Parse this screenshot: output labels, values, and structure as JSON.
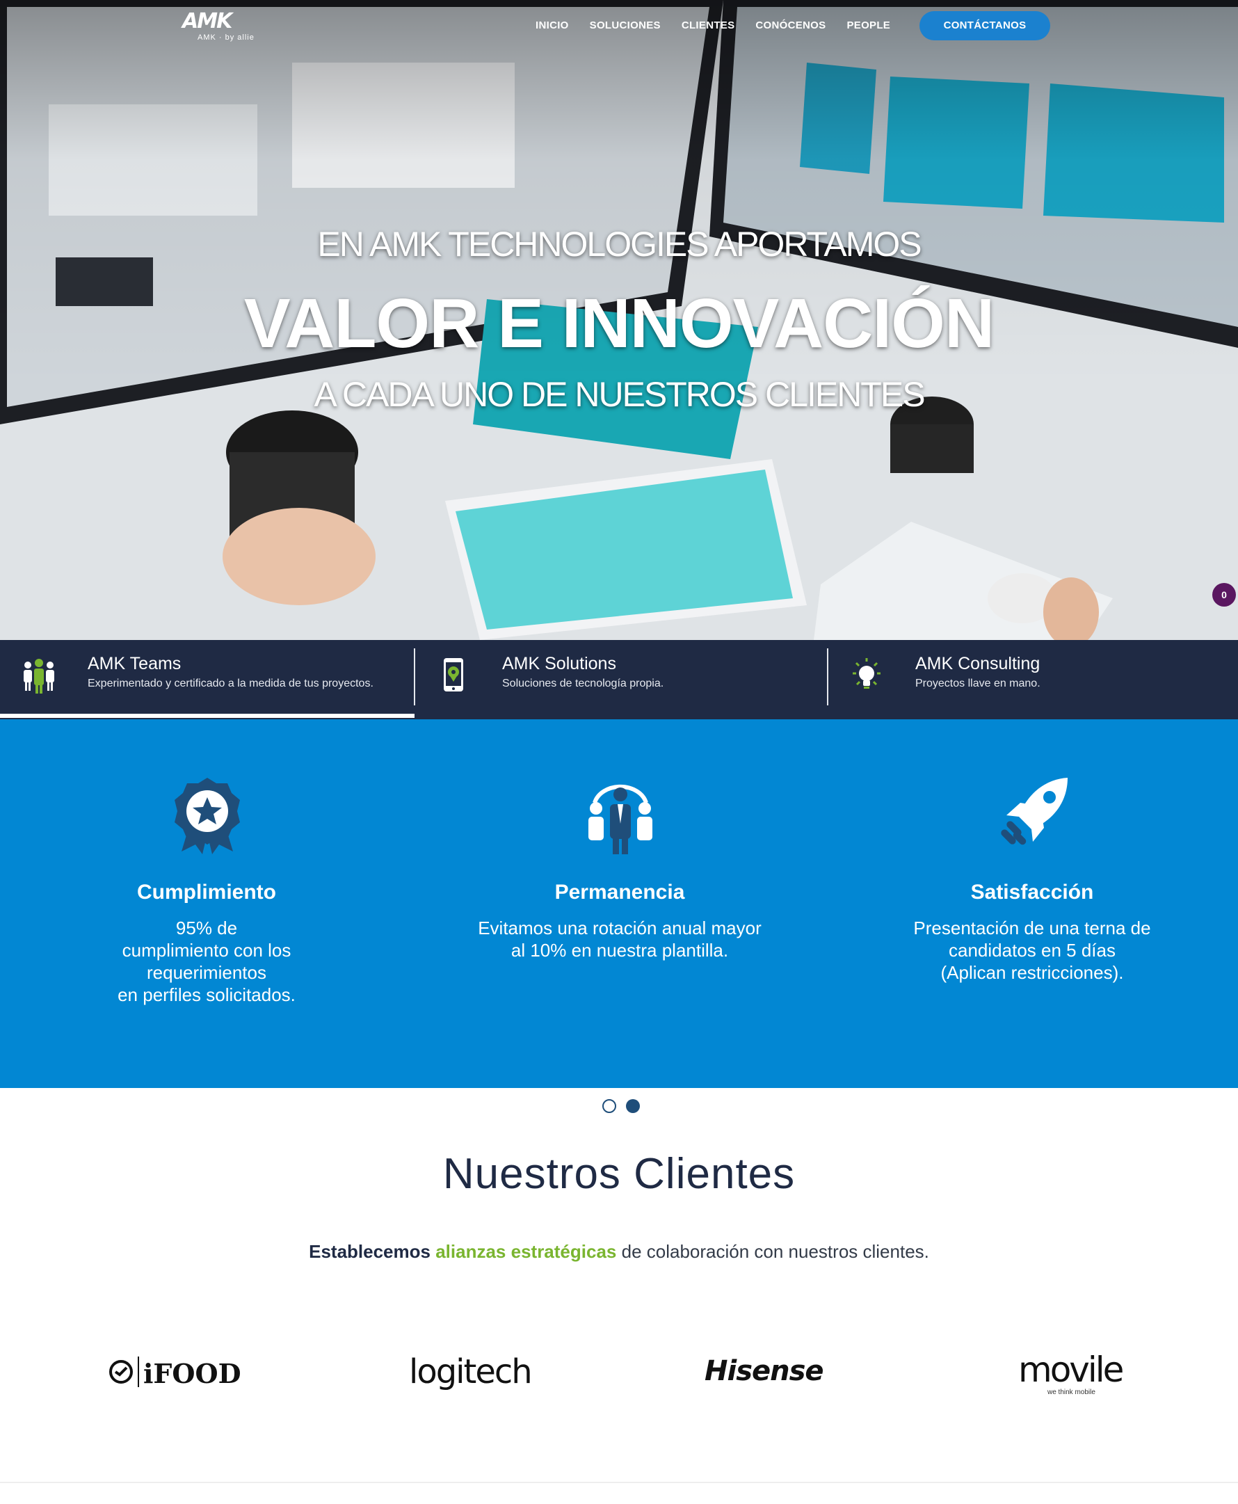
{
  "brand": {
    "logo_text": "AMK",
    "logo_subtext": "AMK · by allie"
  },
  "nav": {
    "items": [
      "INICIO",
      "SOLUCIONES",
      "CLIENTES",
      "CONÓCENOS",
      "PEOPLE"
    ],
    "cta_label": "CONTÁCTANOS"
  },
  "hero": {
    "line1": "EN AMK TECHNOLOGIES APORTAMOS",
    "line2": "VALOR E INNOVACIÓN",
    "line3": "A CADA UNO DE NUESTROS CLIENTES"
  },
  "cart": {
    "count": "0"
  },
  "tabs": [
    {
      "title": "AMK Teams",
      "desc": "Experimentado y certificado a la medida de tus proyectos.",
      "icon": "team-icon",
      "active": true
    },
    {
      "title": "AMK Solutions",
      "desc": "Soluciones de tecnología propia.",
      "icon": "mobile-location-icon",
      "active": false
    },
    {
      "title": "AMK Consulting",
      "desc": "Proyectos llave en mano.",
      "icon": "lightbulb-icon",
      "active": false
    }
  ],
  "features": [
    {
      "title": "Cumplimiento",
      "lines": [
        "95% de",
        "cumplimiento con los",
        "requerimientos",
        "en perfiles solicitados."
      ],
      "icon": "award-star-icon"
    },
    {
      "title": "Permanencia",
      "lines": [
        "Evitamos una rotación anual mayor",
        "al 10% en nuestra plantilla."
      ],
      "icon": "people-group-icon"
    },
    {
      "title": "Satisfacción",
      "lines": [
        "Presentación de una terna de",
        "candidatos en 5 días",
        "(Aplican restricciones)."
      ],
      "icon": "rocket-icon"
    }
  ],
  "slider": {
    "pages": 2,
    "current": 2
  },
  "clients": {
    "title": "Nuestros Clientes",
    "subtitle_bold": "Establecemos",
    "subtitle_green": "alianzas estratégicas",
    "subtitle_rest": "de colaboración con nuestros clientes.",
    "logos": [
      "iFOOD",
      "logitech",
      "Hisense",
      "movile"
    ],
    "movile_tagline": "we think mobile"
  },
  "colors": {
    "nav_bar": "#1f2a44",
    "features_bg": "#0287d3",
    "cta": "#1b81cf",
    "accent_green": "#7ab530",
    "badge": "#5a1760"
  }
}
